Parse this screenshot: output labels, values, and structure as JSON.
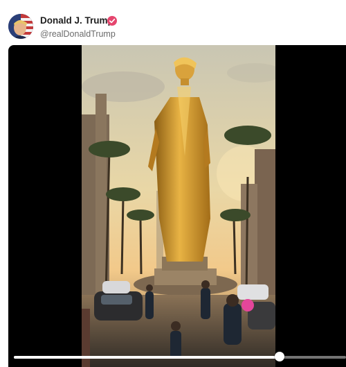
{
  "post": {
    "display_name": "Donald J. Trump",
    "handle": "@realDonaldTrump",
    "verified_icon": "verified-badge-icon",
    "accent_color": "#e5466e"
  },
  "video": {
    "description_icon": "video-thumbnail",
    "progress": 0.8
  }
}
